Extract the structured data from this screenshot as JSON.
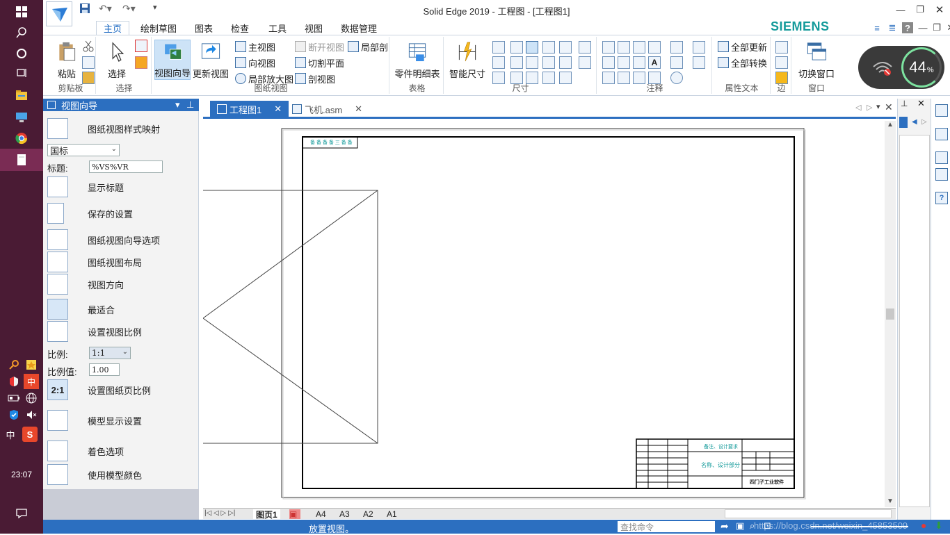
{
  "window": {
    "title": "Solid Edge 2019 - 工程图 - [工程图1]",
    "brand": "SIEMENS",
    "brand_color": "#139a9a",
    "accent_color": "#2c6fc0"
  },
  "taskbar": {
    "clock": "23:07",
    "lang_indicator": "中",
    "ime_label": "中"
  },
  "ribbon_tabs": [
    "主页",
    "绘制草图",
    "图表",
    "检查",
    "工具",
    "视图",
    "数据管理"
  ],
  "active_tab": "主页",
  "ribbon": {
    "clipboard": {
      "paste": "粘贴",
      "group": "剪贴板"
    },
    "select": {
      "select": "选择",
      "group": "选择"
    },
    "drawing_views": {
      "view_wizard": "视图向导",
      "update_views": "更新视图",
      "main_view": "主视图",
      "projected_view": "向视图",
      "detail_view": "局部放大图",
      "broken_view": "断开视图",
      "cutting_plane": "切割平面",
      "section_view": "剖视图",
      "broken_out": "局部剖",
      "group": "图纸视图"
    },
    "tables": {
      "parts_list": "零件明细表",
      "group": "表格"
    },
    "dimension": {
      "smart": "智能尺寸",
      "group": "尺寸"
    },
    "annotation": {
      "group": "注释"
    },
    "property_text": {
      "update_all": "全部更新",
      "convert_all": "全部转换",
      "group": "属性文本"
    },
    "edges": {
      "group": "边"
    },
    "window": {
      "switch": "切换窗口",
      "group": "窗口"
    }
  },
  "network_widget": {
    "percent": "44",
    "unit": "%"
  },
  "view_wizard_pane": {
    "title": "视图向导",
    "style_mapping": "图纸视图样式映射",
    "standard": "国标",
    "caption_label": "标题:",
    "caption_value": "%VS%VR",
    "show_caption": "显示标题",
    "saved_settings": "保存的设置",
    "wizard_options": "图纸视图向导选项",
    "layout": "图纸视图布局",
    "orientation": "视图方向",
    "best_fit": "最适合",
    "set_scale": "设置视图比例",
    "scale_label": "比例:",
    "scale_value": "1:1",
    "scale_val_label": "比例值:",
    "scale_val": "1.00",
    "set_sheet_scale": "设置图纸页比例",
    "model_display": "模型显示设置",
    "shading": "着色选项",
    "use_model_color": "使用模型颜色"
  },
  "doc_tabs": [
    {
      "label": "工程图1",
      "active": true
    },
    {
      "label": "飞机.asm",
      "active": false
    }
  ],
  "sheet_tabs": [
    "图页1",
    "A4",
    "A3",
    "A2",
    "A1"
  ],
  "title_block": {
    "top_left_label": "备 备 备 备  三 备 备",
    "material_text": "备注、设计要求",
    "name_text": "名称、设计部分",
    "company_text": "四门子工业软件"
  },
  "status": {
    "message": "放置视图。",
    "search_placeholder": "查找命令",
    "watermark": "https://blog.csdn.net/weixin_45853509"
  }
}
